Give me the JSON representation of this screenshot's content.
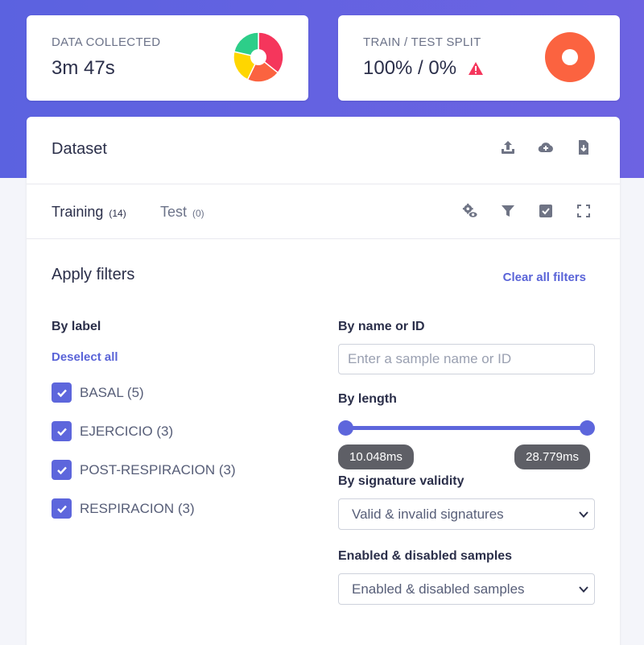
{
  "stats": {
    "data_collected": {
      "label": "DATA COLLECTED",
      "value": "3m 47s",
      "chart_data": {
        "type": "pie",
        "categories": [
          "BASAL",
          "EJERCICIO",
          "POST-RESPIRACION",
          "RESPIRACION"
        ],
        "values": [
          5,
          3,
          3,
          3
        ],
        "colors": [
          "#f5365c",
          "#fb6340",
          "#ffd600",
          "#2dce89"
        ]
      }
    },
    "split": {
      "label": "TRAIN / TEST SPLIT",
      "value": "100% / 0%",
      "warning_icon": "alert-triangle-icon",
      "warning_color": "#f5365c",
      "chart_data": {
        "type": "pie",
        "categories": [
          "Train",
          "Test"
        ],
        "values": [
          100,
          0
        ],
        "colors": [
          "#fb6340",
          "#8898aa"
        ]
      }
    }
  },
  "dataset": {
    "title": "Dataset",
    "header_icons": [
      "upload-icon",
      "cloud-add-icon",
      "download-file-icon"
    ]
  },
  "tabs": [
    {
      "label": "Training",
      "count": "(14)"
    },
    {
      "label": "Test",
      "count": "(0)"
    }
  ],
  "tab_icons": [
    "settings-eye-icon",
    "filter-icon",
    "check-square-icon",
    "fullscreen-icon"
  ],
  "filters": {
    "title": "Apply filters",
    "clear_label": "Clear all filters",
    "by_label": {
      "title": "By label",
      "deselect_label": "Deselect all",
      "items": [
        {
          "label": "BASAL (5)",
          "checked": true
        },
        {
          "label": "EJERCICIO (3)",
          "checked": true
        },
        {
          "label": "POST-RESPIRACION (3)",
          "checked": true
        },
        {
          "label": "RESPIRACION (3)",
          "checked": true
        }
      ]
    },
    "by_name": {
      "title": "By name or ID",
      "placeholder": "Enter a sample name or ID",
      "value": ""
    },
    "by_length": {
      "title": "By length",
      "min_label": "10.048ms",
      "max_label": "28.779ms"
    },
    "by_signature": {
      "title": "By signature validity",
      "selected": "Valid & invalid signatures"
    },
    "by_enabled": {
      "title": "Enabled & disabled samples",
      "selected": "Enabled & disabled samples"
    }
  },
  "colors": {
    "accent": "#5d66dc",
    "hero_gradient_start": "#5b62e0",
    "hero_gradient_end": "#6d63e2",
    "badge_bg": "#5e5f66"
  }
}
